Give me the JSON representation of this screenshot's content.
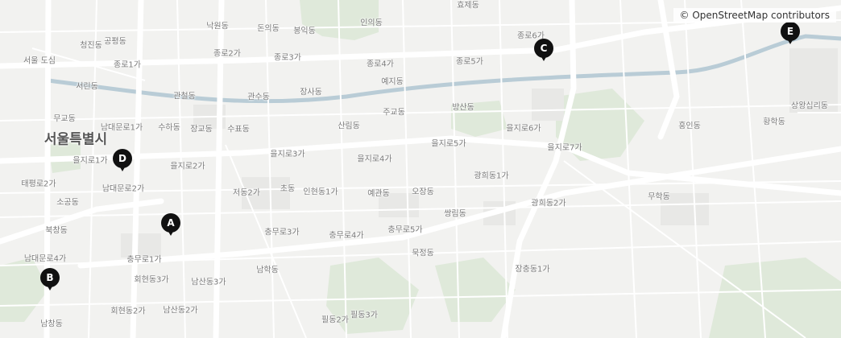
{
  "attribution": "© OpenStreetMap contributors",
  "city_label": "서울특별시",
  "colors": {
    "background": "#f2f2f0",
    "road": "#ffffff",
    "water": "#b9ccd6",
    "park": "#dfe9da",
    "marker": "#111111"
  },
  "markers": [
    {
      "label": "A"
    },
    {
      "label": "B"
    },
    {
      "label": "C"
    },
    {
      "label": "D"
    },
    {
      "label": "E"
    }
  ],
  "place_labels": [
    "효제동",
    "낙원동",
    "돈의동",
    "봉익동",
    "인의동",
    "공평동",
    "종로6가",
    "청진동",
    "종로2가",
    "종로3가",
    "서울 도심",
    "종로1가",
    "종로4가",
    "종로5가",
    "예지동",
    "서린동",
    "관철동",
    "관수동",
    "장사동",
    "무교동",
    "주교동",
    "방산동",
    "상왕십리동",
    "남대문로1가",
    "수하동",
    "장교동",
    "수표동",
    "산림동",
    "을지로6가",
    "흥인동",
    "황학동",
    "을지로5가",
    "을지로7가",
    "을지로3가",
    "을지로4가",
    "을지로1가",
    "을지로2가",
    "태평로2가",
    "광희동1가",
    "남대문로2가",
    "저동2가",
    "초동",
    "인현동1가",
    "예관동",
    "오장동",
    "소공동",
    "무학동",
    "광희동2가",
    "쌍림동",
    "북창동",
    "충무로3가",
    "충무로4가",
    "충무로5가",
    "남대문로4가",
    "충무로1가",
    "묵정동",
    "남학동",
    "회현동3가",
    "남산동3가",
    "장충동1가",
    "회현동2가",
    "남산동2가",
    "필동3가",
    "남창동",
    "필동2가"
  ]
}
